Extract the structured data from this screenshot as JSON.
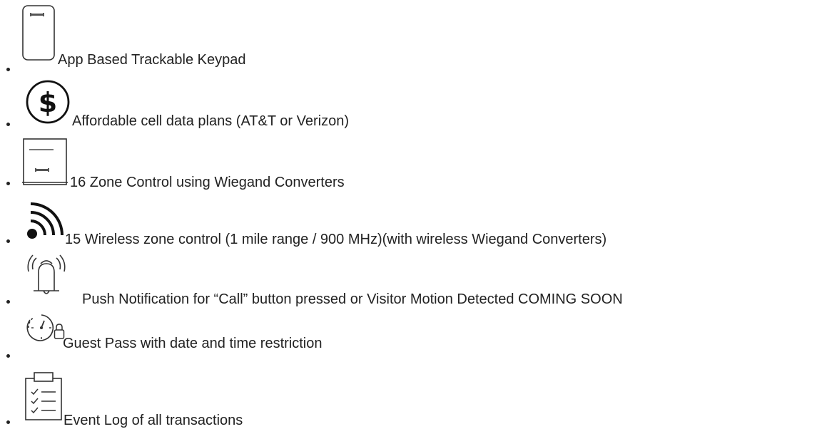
{
  "features": [
    {
      "icon": "smartphone-keypad-icon",
      "label": "App Based Trackable Keypad"
    },
    {
      "icon": "dollar-coin-icon",
      "label": "Affordable cell data plans (AT&T or Verizon)"
    },
    {
      "icon": "wiegand-converter-icon",
      "label": "16 Zone Control using Wiegand Converters"
    },
    {
      "icon": "wireless-signal-icon",
      "label": "15 Wireless zone control (1 mile range / 900 MHz)(with wireless Wiegand Converters)"
    },
    {
      "icon": "ringing-bell-icon",
      "label": "Push Notification for “Call” button pressed or Visitor Motion Detected COMING SOON"
    },
    {
      "icon": "timer-lock-icon",
      "label": "Guest Pass with date and time restriction"
    },
    {
      "icon": "clipboard-checklist-icon",
      "label": "Event Log of all transactions"
    }
  ]
}
